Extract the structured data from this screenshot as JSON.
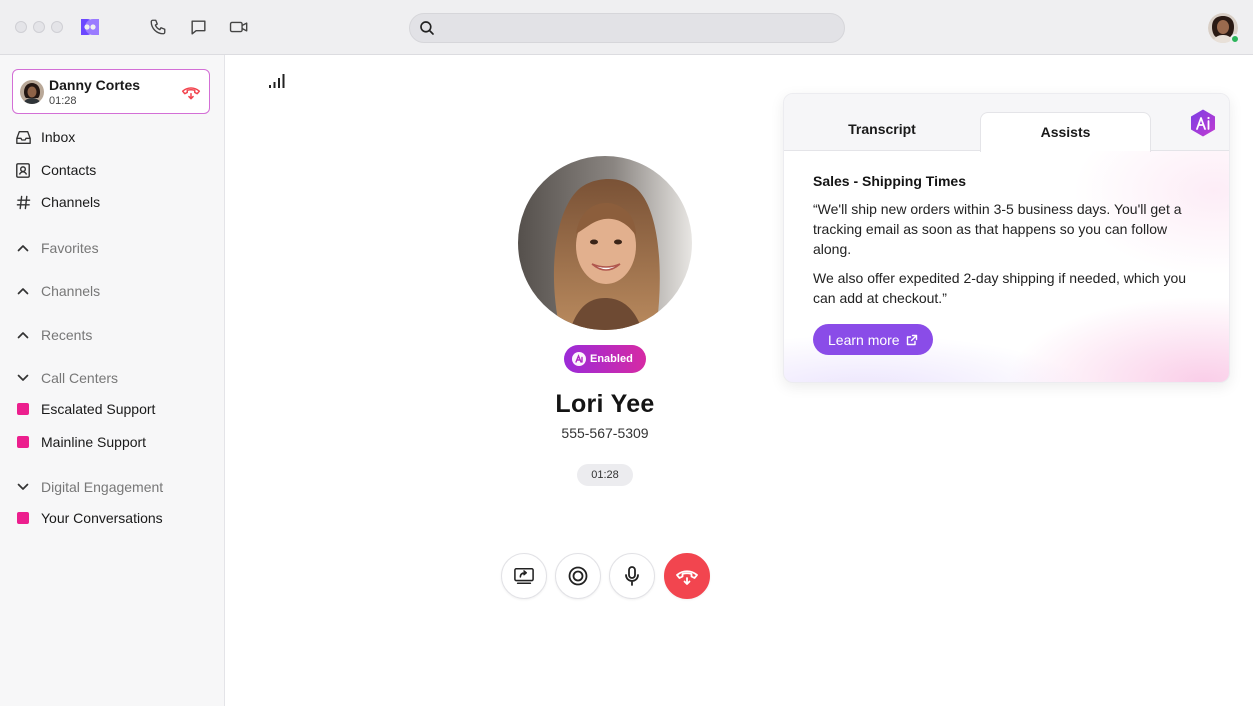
{
  "search": {
    "placeholder": "",
    "value": ""
  },
  "active_call": {
    "name": "Danny Cortes",
    "duration": "01:28"
  },
  "sidebar": {
    "items": [
      {
        "label": "Inbox",
        "icon": "inbox-icon"
      },
      {
        "label": "Contacts",
        "icon": "contacts-icon"
      },
      {
        "label": "Channels",
        "icon": "hash-icon"
      }
    ],
    "sections": [
      {
        "label": "Favorites",
        "state": "collapsed"
      },
      {
        "label": "Channels",
        "state": "collapsed"
      },
      {
        "label": "Recents",
        "state": "collapsed"
      },
      {
        "label": "Call Centers",
        "state": "expanded"
      },
      {
        "label": "Digital Engagement",
        "state": "expanded"
      }
    ],
    "call_centers": [
      {
        "label": "Escalated Support"
      },
      {
        "label": "Mainline Support"
      }
    ],
    "digital_engagement": [
      {
        "label": "Your Conversations"
      }
    ]
  },
  "caller": {
    "name": "Lori Yee",
    "phone": "555-567-5309",
    "badge": "Enabled",
    "timer": "01:28"
  },
  "controls": [
    "screen-share-icon",
    "record-icon",
    "microphone-icon",
    "hang-up-icon"
  ],
  "assist": {
    "tabs": [
      {
        "label": "Transcript",
        "active": false
      },
      {
        "label": "Assists",
        "active": true
      }
    ],
    "heading": "Sales - Shipping Times",
    "paragraph_1": "“We'll ship new orders within 3-5 business days. You'll get a tracking email as soon as that happens so you can follow along.",
    "paragraph_2": "We also offer expedited 2-day shipping if needed, which you can add at checkout.”",
    "button_label": "Learn more"
  },
  "colors": {
    "brand": "#7c4dff",
    "accent_pink": "#ec1f8e",
    "assist_button": "#8a4ce8",
    "hang_up": "#f2454f",
    "online": "#2bb45a"
  }
}
